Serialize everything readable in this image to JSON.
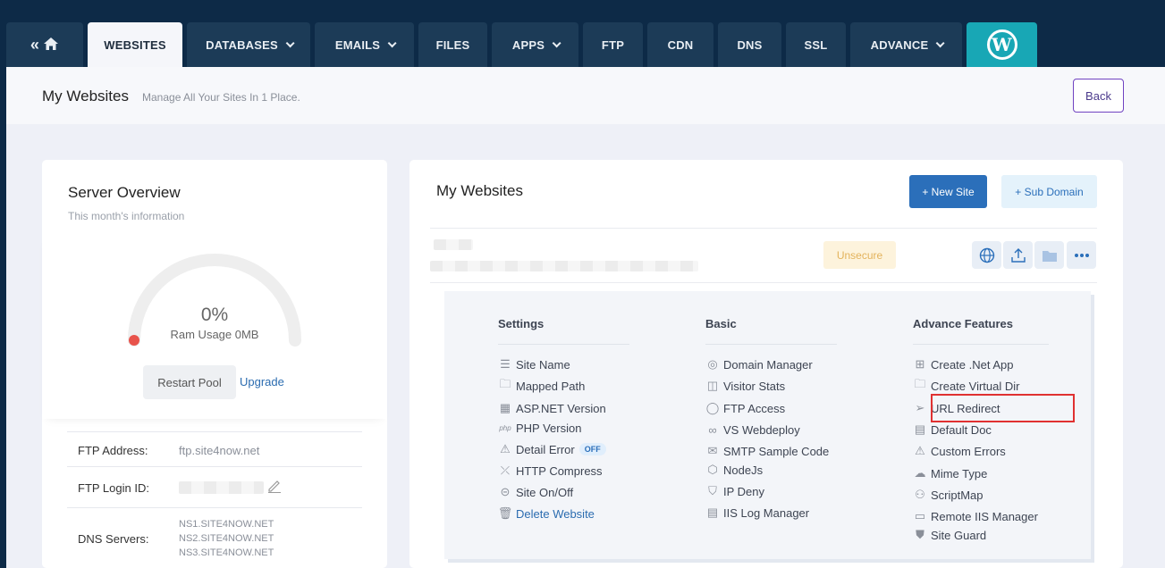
{
  "nav": {
    "tabs": [
      {
        "label": "WEBSITES"
      },
      {
        "label": "DATABASES"
      },
      {
        "label": "EMAILS"
      },
      {
        "label": "FILES"
      },
      {
        "label": "APPS"
      },
      {
        "label": "FTP"
      },
      {
        "label": "CDN"
      },
      {
        "label": "DNS"
      },
      {
        "label": "SSL"
      },
      {
        "label": "ADVANCE"
      }
    ],
    "wp_logo": "W"
  },
  "header": {
    "title": "My Websites",
    "subtitle": "Manage All Your Sites In 1 Place.",
    "back_label": "Back"
  },
  "server_overview": {
    "title": "Server Overview",
    "subtitle": "This month's information",
    "gauge_value": "0%",
    "gauge_label": "Ram Usage 0MB",
    "restart_label": "Restart  Pool",
    "upgrade_label": "Upgrade",
    "ftp_address_label": "FTP Address:",
    "ftp_address_value": "ftp.site4now.net",
    "ftp_login_label": "FTP Login ID:",
    "dns_label": "DNS Servers:",
    "dns_servers": [
      "NS1.SITE4NOW.NET",
      "NS2.SITE4NOW.NET",
      "NS3.SITE4NOW.NET"
    ]
  },
  "websites": {
    "title": "My Websites",
    "new_site_label": "+ New Site",
    "sub_domain_label": "+ Sub Domain",
    "unsecure_label": "Unsecure",
    "settings": {
      "heading": "Settings",
      "items": [
        "Site Name",
        "Mapped Path",
        "ASP.NET Version",
        "PHP Version",
        "Detail Error",
        "HTTP Compress",
        "Site On/Off",
        "Delete Website"
      ],
      "off_badge": "OFF"
    },
    "basic": {
      "heading": "Basic",
      "items": [
        "Domain Manager",
        "Visitor Stats",
        "FTP Access",
        "VS Webdeploy",
        "SMTP Sample Code",
        "NodeJs",
        "IP Deny",
        "IIS Log Manager"
      ]
    },
    "advance": {
      "heading": "Advance Features",
      "items": [
        "Create .Net App",
        "Create Virtual Dir",
        "URL Redirect",
        "Default Doc",
        "Custom Errors",
        "Mime Type",
        "ScriptMap",
        "Remote IIS Manager",
        "Site Guard"
      ]
    }
  },
  "colors": {
    "nav_bg": "#0d2a47",
    "tab_bg": "#1c3b57",
    "accent": "#2b6fba",
    "wp": "#18a7b5",
    "highlight": "#e03131"
  }
}
